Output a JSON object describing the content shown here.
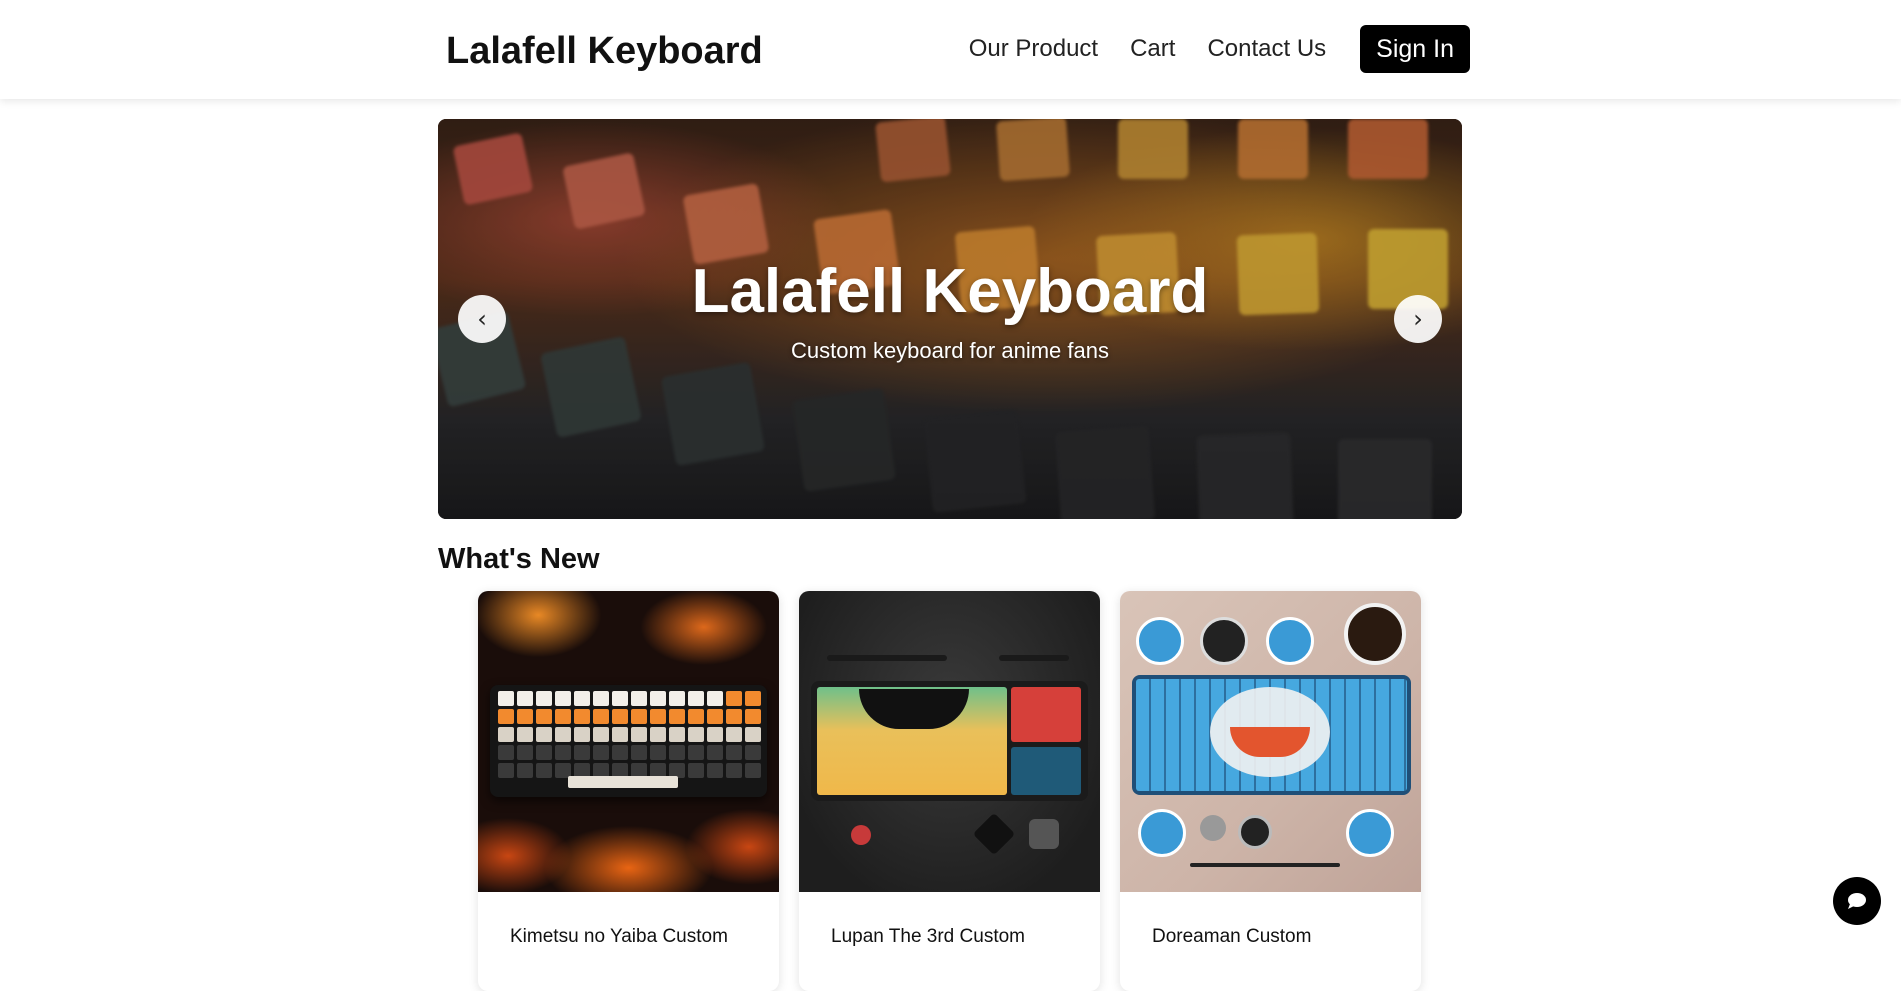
{
  "header": {
    "brand": "Lalafell Keyboard",
    "nav": [
      {
        "label": "Our Product"
      },
      {
        "label": "Cart"
      },
      {
        "label": "Contact Us"
      }
    ],
    "signin_label": "Sign In"
  },
  "hero": {
    "title": "Lalafell Keyboard",
    "subtitle": "Custom keyboard for anime fans",
    "prev_label": "‹",
    "next_label": "›"
  },
  "whats_new": {
    "title": "What's New",
    "products": [
      {
        "title": "Kimetsu no Yaiba Custom",
        "image_icon": "flame-keyboard-image"
      },
      {
        "title": "Lupan The 3rd Custom",
        "image_icon": "green-yellow-keyboard-image"
      },
      {
        "title": "Doreaman Custom",
        "image_icon": "blue-keyboard-image"
      }
    ]
  },
  "chat": {
    "icon": "chat-bubble-icon"
  },
  "colors": {
    "accent": "#000000",
    "background": "#ffffff"
  }
}
